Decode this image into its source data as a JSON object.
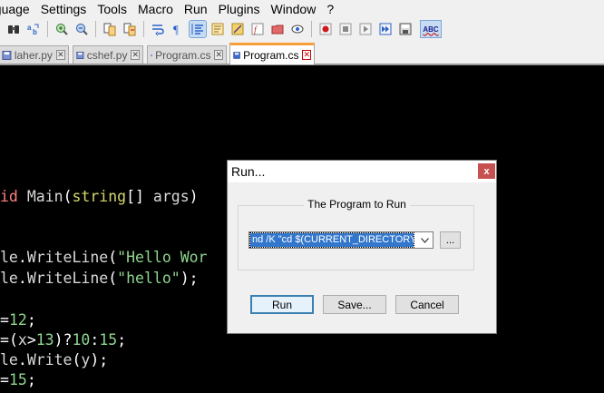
{
  "menu": [
    "nguage",
    "Settings",
    "Tools",
    "Macro",
    "Run",
    "Plugins",
    "Window",
    "?"
  ],
  "toolbar": {
    "icons": [
      "find-replace-icon",
      "replace-icon",
      "zoom-in-icon",
      "zoom-out-icon",
      "sync-vertical-icon",
      "sync-horizontal-icon",
      "wrap-icon",
      "show-all-chars-icon",
      "indent-guide-icon",
      "user-lang-icon",
      "doc-map-icon",
      "function-list-icon",
      "folder-workspace-icon",
      "monitor-icon",
      "record-macro-icon",
      "stop-macro-icon",
      "play-macro-icon",
      "run-macro-multiple-icon",
      "save-macro-icon",
      "spell-check-icon"
    ],
    "spell_check_label": "ABC"
  },
  "tabs": [
    {
      "label": "laher.py",
      "active": false
    },
    {
      "label": "cshef.py",
      "active": false
    },
    {
      "label": "Program.cs",
      "active": false
    },
    {
      "label": "Program.cs",
      "active": true
    }
  ],
  "editor": {
    "lines": [
      {
        "parts": [
          {
            "t": "id ",
            "c": "kw"
          },
          {
            "t": "Main",
            "c": "id"
          },
          {
            "t": "(",
            "c": "op"
          },
          {
            "t": "string",
            "c": "ty"
          },
          {
            "t": "[]",
            "c": "op"
          },
          {
            "t": " args",
            "c": "id"
          },
          {
            "t": ")",
            "c": "op"
          }
        ]
      },
      {
        "parts": [
          {
            "t": "le",
            "c": "id"
          },
          {
            "t": ".",
            "c": "op"
          },
          {
            "t": "WriteLine",
            "c": "id"
          },
          {
            "t": "(",
            "c": "op"
          },
          {
            "t": "\"Hello Wor",
            "c": "str"
          }
        ]
      },
      {
        "parts": [
          {
            "t": "le",
            "c": "id"
          },
          {
            "t": ".",
            "c": "op"
          },
          {
            "t": "WriteLine",
            "c": "id"
          },
          {
            "t": "(",
            "c": "op"
          },
          {
            "t": "\"hello\"",
            "c": "str"
          },
          {
            "t": ");",
            "c": "op"
          }
        ]
      },
      {
        "parts": [
          {
            "t": "=",
            "c": "op"
          },
          {
            "t": "12",
            "c": "num"
          },
          {
            "t": ";",
            "c": "op"
          }
        ]
      },
      {
        "parts": [
          {
            "t": "=",
            "c": "op"
          },
          {
            "t": "(",
            "c": "op"
          },
          {
            "t": "x",
            "c": "id"
          },
          {
            "t": ">",
            "c": "op"
          },
          {
            "t": "13",
            "c": "num"
          },
          {
            "t": ")?",
            "c": "op"
          },
          {
            "t": "10",
            "c": "num"
          },
          {
            "t": ":",
            "c": "op"
          },
          {
            "t": "15",
            "c": "num"
          },
          {
            "t": ";",
            "c": "op"
          }
        ]
      },
      {
        "parts": [
          {
            "t": "le",
            "c": "id"
          },
          {
            "t": ".",
            "c": "op"
          },
          {
            "t": "Write",
            "c": "id"
          },
          {
            "t": "(",
            "c": "op"
          },
          {
            "t": "y",
            "c": "id"
          },
          {
            "t": ");",
            "c": "op"
          }
        ]
      },
      {
        "parts": [
          {
            "t": "=",
            "c": "op"
          },
          {
            "t": "15",
            "c": "num"
          },
          {
            "t": ";",
            "c": "op"
          }
        ]
      }
    ]
  },
  "dialog": {
    "title": "Run...",
    "close_label": "x",
    "group_label": "The Program to Run",
    "command_value": "nd /K \"cd $(CURRENT_DIRECTORY)\"",
    "browse_label": "...",
    "buttons": {
      "run": "Run",
      "save": "Save...",
      "cancel": "Cancel"
    }
  }
}
